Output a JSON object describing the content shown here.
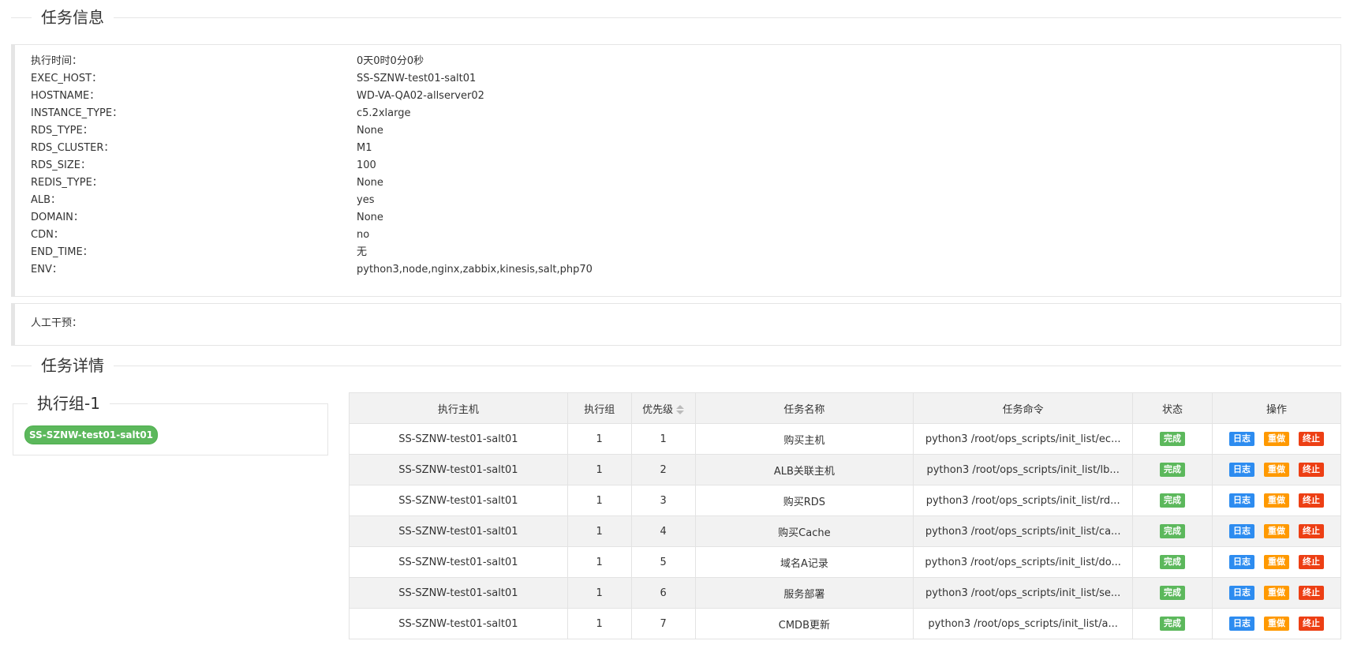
{
  "info_section": {
    "title": "任务信息",
    "fields": [
      {
        "key": "执行时间：",
        "value": "0天0时0分0秒"
      },
      {
        "key": "EXEC_HOST：",
        "value": "SS-SZNW-test01-salt01"
      },
      {
        "key": "HOSTNAME：",
        "value": "WD-VA-QA02-allserver02"
      },
      {
        "key": "INSTANCE_TYPE：",
        "value": "c5.2xlarge"
      },
      {
        "key": "RDS_TYPE：",
        "value": "None"
      },
      {
        "key": "RDS_CLUSTER：",
        "value": "M1"
      },
      {
        "key": "RDS_SIZE：",
        "value": "100"
      },
      {
        "key": "REDIS_TYPE：",
        "value": "None"
      },
      {
        "key": "ALB：",
        "value": "yes"
      },
      {
        "key": "DOMAIN：",
        "value": "None"
      },
      {
        "key": "CDN：",
        "value": "no"
      },
      {
        "key": "END_TIME：",
        "value": "无"
      },
      {
        "key": "ENV：",
        "value": "python3,node,nginx,zabbix,kinesis,salt,php70"
      }
    ],
    "manual_label": "人工干预："
  },
  "detail_section": {
    "title": "任务详情",
    "group_title": "执行组-1",
    "group_host": "SS-SZNW-test01-salt01"
  },
  "table": {
    "headers": [
      "执行主机",
      "执行组",
      "优先级",
      "任务名称",
      "任务命令",
      "状态",
      "操作"
    ],
    "rows": [
      {
        "host": "SS-SZNW-test01-salt01",
        "group": "1",
        "priority": "1",
        "name": "购买主机",
        "command": "python3 /root/ops_scripts/init_list/ec...",
        "status": "完成"
      },
      {
        "host": "SS-SZNW-test01-salt01",
        "group": "1",
        "priority": "2",
        "name": "ALB关联主机",
        "command": "python3 /root/ops_scripts/init_list/lb...",
        "status": "完成"
      },
      {
        "host": "SS-SZNW-test01-salt01",
        "group": "1",
        "priority": "3",
        "name": "购买RDS",
        "command": "python3 /root/ops_scripts/init_list/rd...",
        "status": "完成"
      },
      {
        "host": "SS-SZNW-test01-salt01",
        "group": "1",
        "priority": "4",
        "name": "购买Cache",
        "command": "python3 /root/ops_scripts/init_list/ca...",
        "status": "完成"
      },
      {
        "host": "SS-SZNW-test01-salt01",
        "group": "1",
        "priority": "5",
        "name": "域名A记录",
        "command": "python3 /root/ops_scripts/init_list/do...",
        "status": "完成"
      },
      {
        "host": "SS-SZNW-test01-salt01",
        "group": "1",
        "priority": "6",
        "name": "服务部署",
        "command": "python3 /root/ops_scripts/init_list/se...",
        "status": "完成"
      },
      {
        "host": "SS-SZNW-test01-salt01",
        "group": "1",
        "priority": "7",
        "name": "CMDB更新",
        "command": "python3 /root/ops_scripts/init_list/a...",
        "status": "完成"
      }
    ],
    "actions": {
      "log": "日志",
      "redo": "重做",
      "stop": "终止"
    }
  },
  "colors": {
    "done": "#5cb85c",
    "log": "#2d8cf0",
    "redo": "#ff9900",
    "stop": "#ed3f14"
  }
}
